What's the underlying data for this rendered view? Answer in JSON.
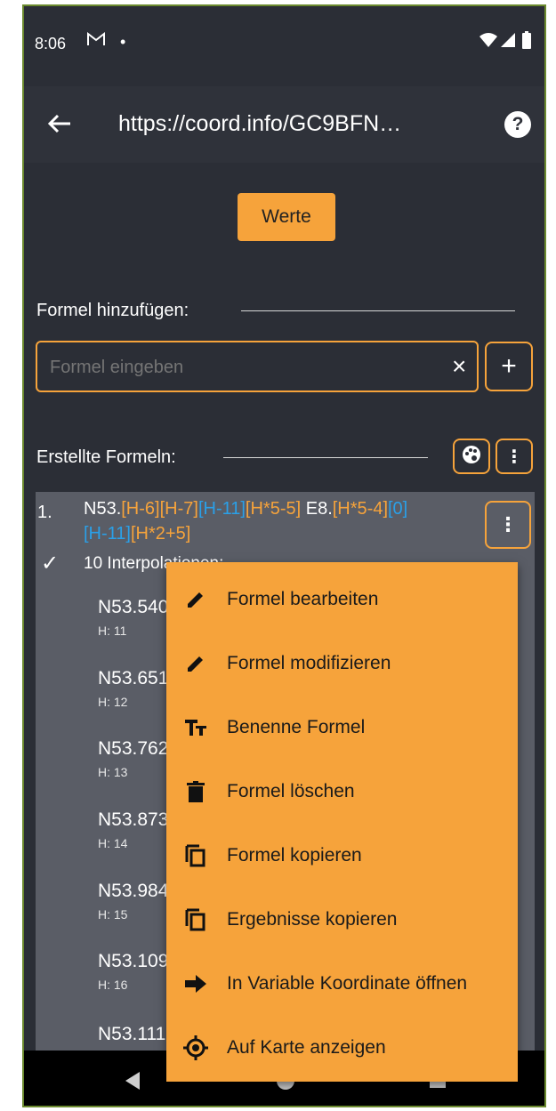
{
  "status": {
    "time": "8:06",
    "notif_icon": "gmail-icon",
    "dot": "•"
  },
  "appbar": {
    "title": "https://coord.info/GC9BFN…",
    "back_icon": "arrow-back-icon",
    "help_icon": "help-icon"
  },
  "werte_button": "Werte",
  "add_formula": {
    "label": "Formel hinzufügen:",
    "placeholder": "Formel eingeben",
    "clear": "×",
    "add": "+"
  },
  "created": {
    "label": "Erstellte Formeln:"
  },
  "formula": {
    "index": "1.",
    "parts_line1": [
      {
        "t": "N53.",
        "c": "white"
      },
      {
        "t": "[H-6]",
        "c": "orange"
      },
      {
        "t": "[H-7]",
        "c": "orange"
      },
      {
        "t": "[H-11]",
        "c": "blue"
      },
      {
        "t": "[H*5-5]",
        "c": "orange"
      },
      {
        "t": " E8.",
        "c": "white"
      },
      {
        "t": "[H*5-4]",
        "c": "orange"
      },
      {
        "t": "[0]",
        "c": "blue"
      }
    ],
    "parts_line2": [
      {
        "t": "[H-11]",
        "c": "blue"
      },
      {
        "t": "[H*2+5]",
        "c": "orange"
      }
    ],
    "interp": "10 Interpolationen:",
    "results": [
      {
        "value": "N53.540",
        "h": "H: 11"
      },
      {
        "value": "N53.651",
        "h": "H: 12"
      },
      {
        "value": "N53.762",
        "h": "H: 13"
      },
      {
        "value": "N53.873",
        "h": "H: 14"
      },
      {
        "value": "N53.984",
        "h": "H: 15"
      },
      {
        "value": "N53.109",
        "h": "H: 16"
      },
      {
        "value": "N53.111",
        "h": ""
      }
    ]
  },
  "menu": [
    {
      "label": "Formel bearbeiten",
      "icon": "pencil-icon"
    },
    {
      "label": "Formel modifizieren",
      "icon": "pencil-icon"
    },
    {
      "label": "Benenne Formel",
      "icon": "text-fields-icon"
    },
    {
      "label": "Formel löschen",
      "icon": "trash-icon"
    },
    {
      "label": "Formel kopieren",
      "icon": "copy-icon"
    },
    {
      "label": "Ergebnisse kopieren",
      "icon": "copy-icon"
    },
    {
      "label": "In Variable Koordinate öffnen",
      "icon": "arrow-right-icon"
    },
    {
      "label": "Auf Karte anzeigen",
      "icon": "gps-target-icon"
    }
  ],
  "colors": {
    "accent": "#f6a33b",
    "background": "#2b2e36",
    "card": "#5a5d66",
    "blue": "#2aa0e8",
    "green": "#8bc34a"
  }
}
